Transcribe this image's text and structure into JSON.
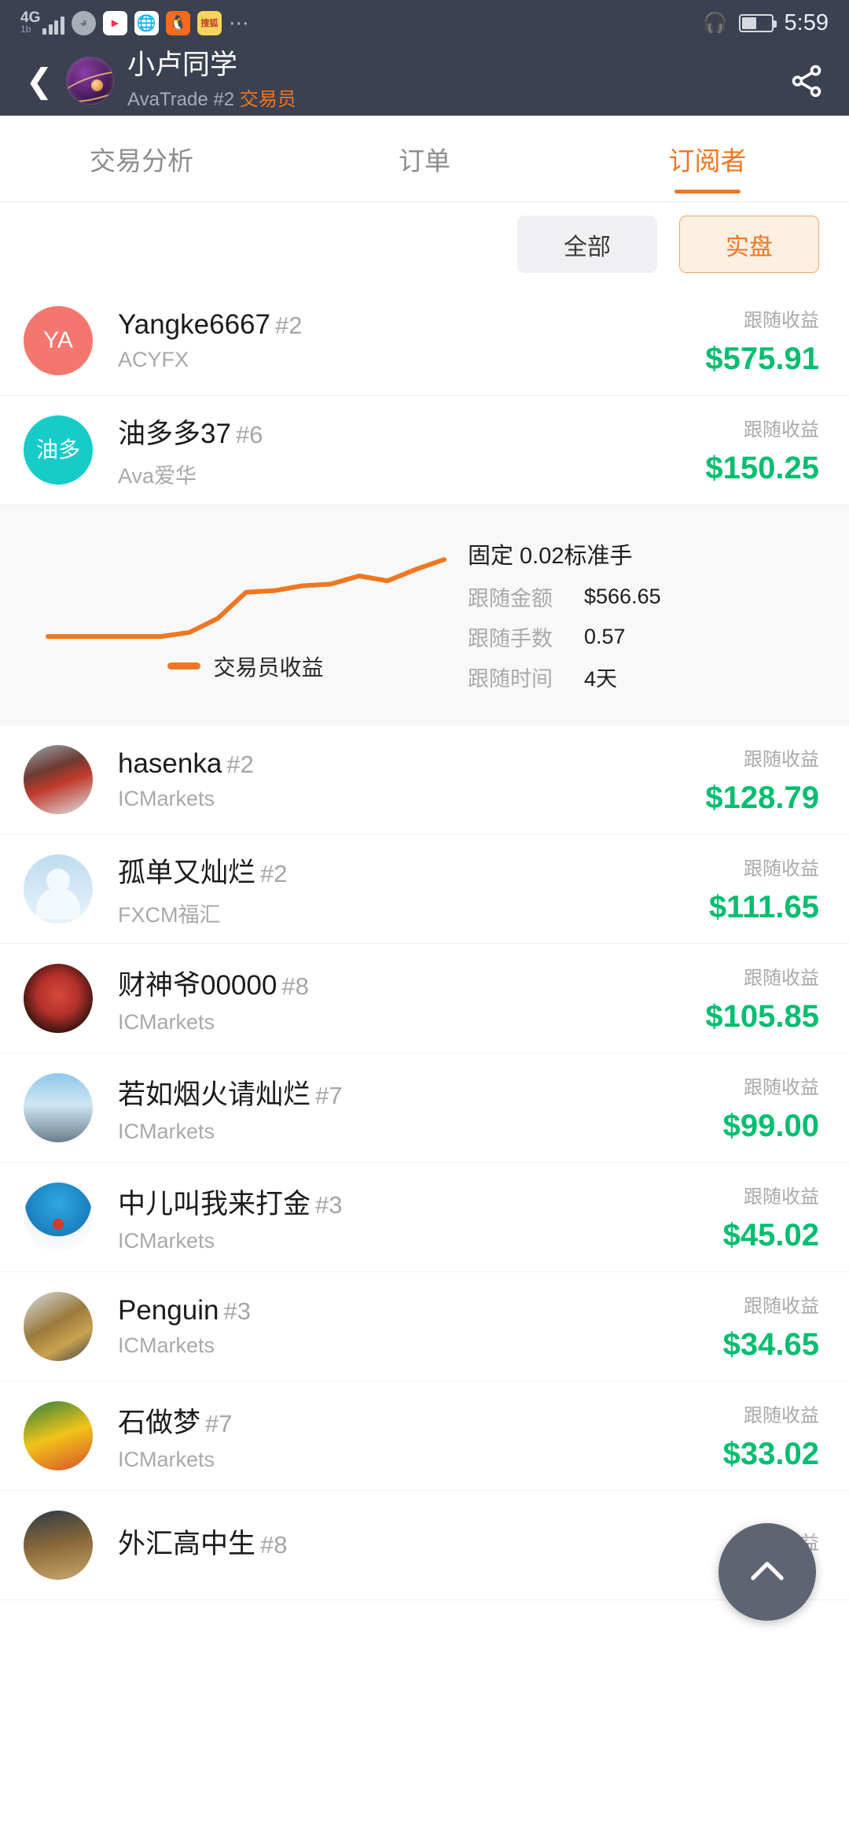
{
  "statusbar": {
    "network_type": "4G",
    "network_sub": "1b",
    "icons": [
      "signal-icon",
      "uc-mobile-icon",
      "youku-icon",
      "browser-icon",
      "uc-browser-icon",
      "sohu-news-icon",
      "overflow-dots-icon"
    ],
    "app_labels": {
      "youku": "YOUKU",
      "sohu": "搜狐"
    },
    "headset": "headset-icon",
    "time": "5:59"
  },
  "header": {
    "back": "back-arrow",
    "trader_name": "小卢同学",
    "broker": "AvaTrade",
    "account_no": "#2",
    "role": "交易员",
    "share": "share-icon"
  },
  "tabs": [
    {
      "label": "交易分析",
      "active": false
    },
    {
      "label": "订单",
      "active": false
    },
    {
      "label": "订阅者",
      "active": true
    }
  ],
  "filters": [
    {
      "label": "全部",
      "active": false
    },
    {
      "label": "实盘",
      "active": true
    }
  ],
  "list": {
    "profit_label": "跟随收益",
    "rows": [
      {
        "avatar": "av-ya",
        "initials": "YA",
        "name": "Yangke6667",
        "num": "#2",
        "broker": "ACYFX",
        "profit": "$575.91"
      },
      {
        "avatar": "av-you",
        "initials": "油多",
        "name": "油多多37",
        "num": "#6",
        "broker": "Ava爱华",
        "profit": "$150.25"
      },
      {
        "avatar": "av-img1",
        "initials": "",
        "name": "hasenka",
        "num": "#2",
        "broker": "ICMarkets",
        "profit": "$128.79"
      },
      {
        "avatar": "av-person",
        "initials": "",
        "name": "孤单又灿烂",
        "num": "#2",
        "broker": "FXCM福汇",
        "profit": "$111.65"
      },
      {
        "avatar": "av-img2",
        "initials": "",
        "name": "财神爷00000",
        "num": "#8",
        "broker": "ICMarkets",
        "profit": "$105.85"
      },
      {
        "avatar": "av-img3",
        "initials": "",
        "name": "若如烟火请灿烂",
        "num": "#7",
        "broker": "ICMarkets",
        "profit": "$99.00"
      },
      {
        "avatar": "av-dora",
        "initials": "",
        "name": "中儿叫我来打金",
        "num": "#3",
        "broker": "ICMarkets",
        "profit": "$45.02"
      },
      {
        "avatar": "av-bull",
        "initials": "",
        "name": "Penguin",
        "num": "#3",
        "broker": "ICMarkets",
        "profit": "$34.65"
      },
      {
        "avatar": "av-game",
        "initials": "",
        "name": "石做梦",
        "num": "#7",
        "broker": "ICMarkets",
        "profit": "$33.02"
      },
      {
        "avatar": "av-temple",
        "initials": "",
        "name": "外汇高中生",
        "num": "#8",
        "broker": "",
        "profit": ""
      }
    ]
  },
  "detail": {
    "title": "固定 0.02标准手",
    "stats": [
      {
        "key": "跟随金额",
        "value": "$566.65"
      },
      {
        "key": "跟随手数",
        "value": "0.57"
      },
      {
        "key": "跟随时间",
        "value": "4天"
      }
    ],
    "legend_label": "交易员收益"
  },
  "fab": {
    "icon": "chevron-up-icon"
  },
  "colors": {
    "accent": "#ef7722",
    "profit_green": "#00bd6f",
    "header_bg": "#3b4150",
    "chip_active_bg": "#fdefe1"
  },
  "chart_data": {
    "type": "line",
    "title": "交易员收益",
    "series": [
      {
        "name": "交易员收益",
        "values": [
          0,
          0,
          0,
          0,
          0,
          0.5,
          2.2,
          5.4,
          5.6,
          6.2,
          6.4,
          7.4,
          6.8,
          8.2,
          9.4
        ]
      }
    ],
    "x": [
      0,
      1,
      2,
      3,
      4,
      5,
      6,
      7,
      8,
      9,
      10,
      11,
      12,
      13,
      14
    ],
    "xlabel": "",
    "ylabel": "",
    "ylim": [
      0,
      10
    ],
    "grid": false,
    "legend_position": "bottom",
    "line_color": "#ef7722"
  }
}
